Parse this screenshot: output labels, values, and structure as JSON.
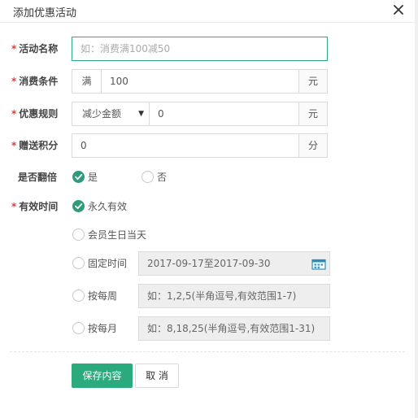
{
  "dialog": {
    "title": "添加优惠活动"
  },
  "form": {
    "name": {
      "required_mark": "*",
      "label": "活动名称",
      "placeholder": "如：消费满100减50"
    },
    "condition": {
      "required_mark": "*",
      "label": "消费条件",
      "prefix": "满",
      "value": "100",
      "suffix": "元"
    },
    "rule": {
      "required_mark": "*",
      "label": "优惠规则",
      "selected": "减少金额",
      "value": "0",
      "suffix": "元"
    },
    "points": {
      "required_mark": "*",
      "label": "赠送积分",
      "value": "0",
      "suffix": "分"
    },
    "double": {
      "label": "是否翻倍",
      "options": [
        "是",
        "否"
      ],
      "selected": "是"
    },
    "validity": {
      "required_mark": "*",
      "label": "有效时间",
      "options": [
        {
          "label": "永久有效",
          "checked": true
        },
        {
          "label": "会员生日当天",
          "checked": false
        },
        {
          "label": "固定时间",
          "checked": false,
          "value": "2017-09-17至2017-09-30"
        },
        {
          "label": "按每周",
          "checked": false,
          "placeholder": "如：1,2,5(半角逗号,有效范围1-7)"
        },
        {
          "label": "按每月",
          "checked": false,
          "placeholder": "如：8,18,25(半角逗号,有效范围1-31)"
        }
      ]
    }
  },
  "actions": {
    "save_label": "保存内容",
    "cancel_label": "取 消"
  },
  "colors": {
    "accent": "#2bab7d",
    "required": "#e23a3a"
  },
  "icons": [
    "close-icon",
    "check-icon",
    "calendar-icon",
    "caret-down-icon"
  ]
}
